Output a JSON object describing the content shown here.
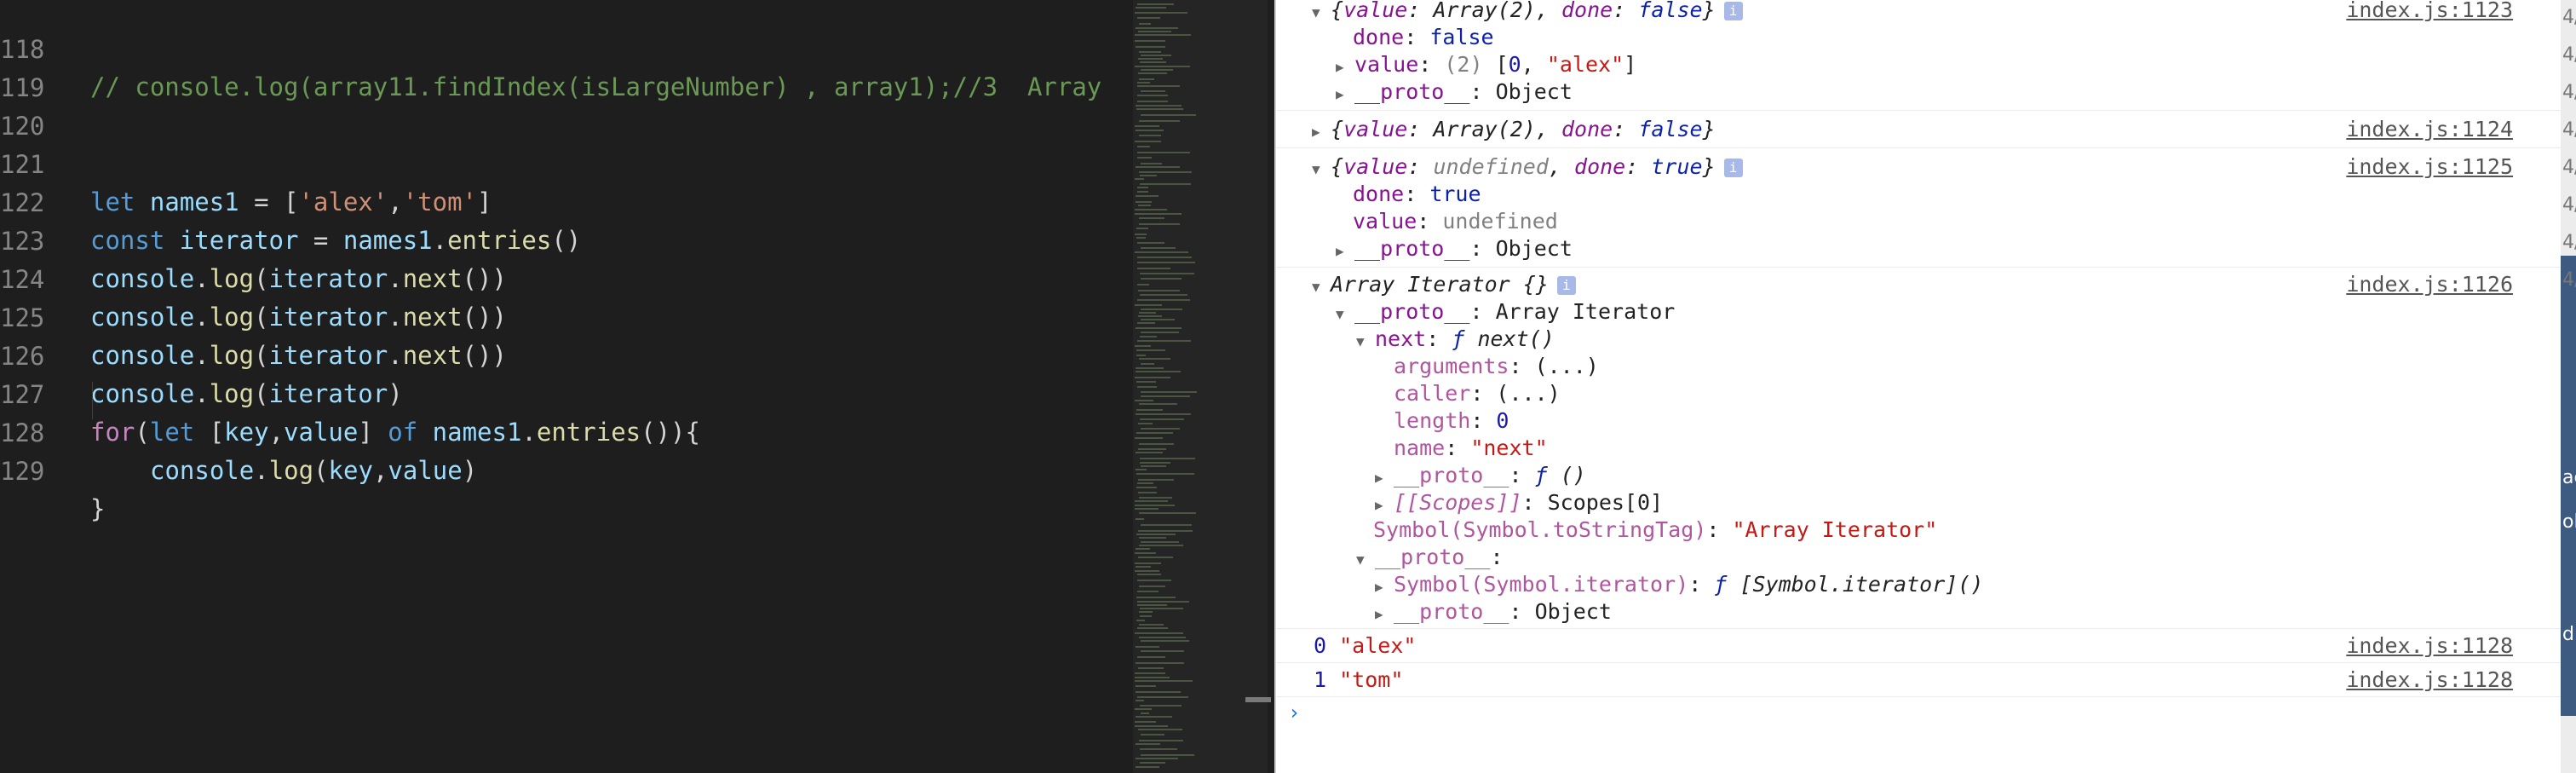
{
  "editor": {
    "line_numbers": [
      "118",
      "119",
      "120",
      "121",
      "122",
      "123",
      "124",
      "125",
      "126",
      "127",
      "128",
      "129"
    ],
    "line118": "// console.log(array11.findIndex(isLargeNumber) , array1);//3  Array",
    "line121": {
      "let": "let",
      "names1": "names1",
      "eq": " = [",
      "s1": "'alex'",
      "comma": ",",
      "s2": "'tom'",
      "close": "]"
    },
    "line122": {
      "const": "const",
      "iterator": "iterator",
      "eq": " = ",
      "names1": "names1",
      "dot": ".",
      "entries": "entries",
      "parens": "()"
    },
    "line123": {
      "console": "console",
      "dot": ".",
      "log": "log",
      "open": "(",
      "iterator": "iterator",
      "dot2": ".",
      "next": "next",
      "close": "())"
    },
    "line124": {
      "console": "console",
      "dot": ".",
      "log": "log",
      "open": "(",
      "iterator": "iterator",
      "dot2": ".",
      "next": "next",
      "close": "())"
    },
    "line125": {
      "console": "console",
      "dot": ".",
      "log": "log",
      "open": "(",
      "iterator": "iterator",
      "dot2": ".",
      "next": "next",
      "close": "())"
    },
    "line126": {
      "console": "console",
      "dot": ".",
      "log": "log",
      "open": "(",
      "iterator": "iterator",
      "close": ")"
    },
    "line127": {
      "for": "for",
      "open": "(",
      "let": "let",
      "br": " [",
      "key": "key",
      "comma": ",",
      "value": "value",
      "br2": "] ",
      "of": "of",
      "sp": " ",
      "names1": "names1",
      "dot": ".",
      "entries": "entries",
      "close": "()){"
    },
    "line128": {
      "console": "console",
      "dot": ".",
      "log": "log",
      "open": "(",
      "key": "key",
      "comma": ",",
      "value": "value",
      "close": ")"
    },
    "line129": "}"
  },
  "console": {
    "m1": {
      "summary": {
        "open": "{",
        "k1": "value",
        "sep1": ": ",
        "v1": "Array(2)",
        "sep2": ", ",
        "k2": "done",
        "sep3": ": ",
        "v2": "false",
        "close": "}"
      },
      "source": "index.js:1123",
      "done_key": "done",
      "done_val": "false",
      "value_key": "value",
      "value_count": "(2)",
      "value_open": " [",
      "value_0": "0",
      "value_sep": ", ",
      "value_1": "\"alex\"",
      "value_close": "]",
      "proto_key": "__proto__",
      "proto_val": "Object"
    },
    "m2": {
      "summary": {
        "open": "{",
        "k1": "value",
        "sep1": ": ",
        "v1": "Array(2)",
        "sep2": ", ",
        "k2": "done",
        "sep3": ": ",
        "v2": "false",
        "close": "}"
      },
      "source": "index.js:1124"
    },
    "m3": {
      "summary": {
        "open": "{",
        "k1": "value",
        "sep1": ": ",
        "v1": "undefined",
        "sep2": ", ",
        "k2": "done",
        "sep3": ": ",
        "v2": "true",
        "close": "}"
      },
      "source": "index.js:1125",
      "done_key": "done",
      "done_val": "true",
      "value_key": "value",
      "value_val": "undefined",
      "proto_key": "__proto__",
      "proto_val": "Object"
    },
    "m4": {
      "summary": "Array Iterator {}",
      "source": "index.js:1126",
      "proto_key": "__proto__",
      "proto_val": "Array Iterator",
      "next_key": "next",
      "next_f": "ƒ",
      "next_val": "next()",
      "arguments_key": "arguments",
      "arguments_val": "(...)",
      "caller_key": "caller",
      "caller_val": "(...)",
      "length_key": "length",
      "length_val": "0",
      "name_key": "name",
      "name_val": "\"next\"",
      "fproto_key": "__proto__",
      "fproto_f": "ƒ",
      "fproto_val": "()",
      "scopes_key": "[[Scopes]]",
      "scopes_val": "Scopes[0]",
      "tostringtag_key": "Symbol(Symbol.toStringTag)",
      "tostringtag_val": "\"Array Iterator\"",
      "proto2_key": "__proto__",
      "symiter_key": "Symbol(Symbol.iterator)",
      "symiter_f": "ƒ",
      "symiter_val": "[Symbol.iterator]()",
      "proto3_key": "__proto__",
      "proto3_val": "Object"
    },
    "m5": {
      "idx": "0",
      "val": "\"alex\"",
      "source": "index.js:1128"
    },
    "m6": {
      "idx": "1",
      "val": "\"tom\"",
      "source": "index.js:1128"
    },
    "prompt": "›",
    "info_icon": "i",
    "tri_open": "▼",
    "tri_closed": "▶"
  },
  "edge_text": [
    "4/",
    "4/",
    "4/",
    "4/",
    "4/",
    "4/",
    "4/",
    "4/",
    "ac",
    "ol",
    "d"
  ],
  "colors": {
    "editor_bg": "#1e1e1e",
    "devtools_bg": "#ffffff",
    "keyword": "#569cd6",
    "string": "#ce9178",
    "comment": "#6a9955",
    "variable": "#9cdcfe",
    "function": "#dcdcaa"
  }
}
